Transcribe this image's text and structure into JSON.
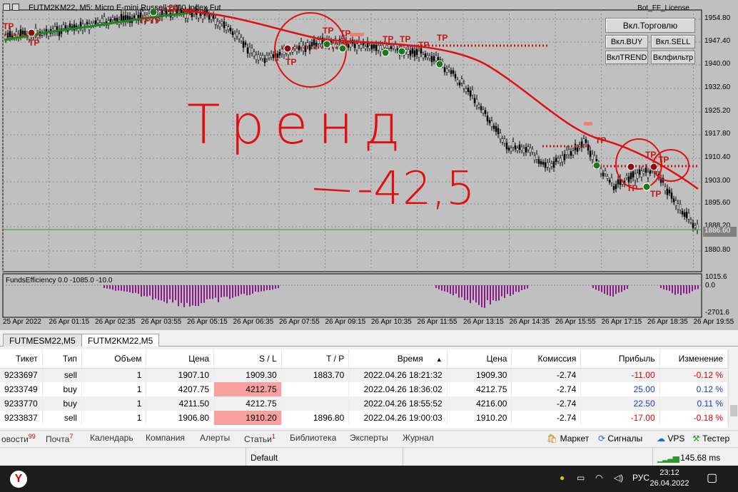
{
  "window": {
    "chart_title": "FUTM2KM22, M5:  Micro E-mini Russell 2000 Index Fut",
    "license_label": "Bot_FF_License"
  },
  "bot_buttons": {
    "trade_on": "Вкл.Торговлю",
    "buy_on": "Вкл.BUY",
    "sell_on": "Вкл.SELL",
    "trend_on": "ВклTREND",
    "filter_on": "Вклфильтр"
  },
  "price_axis": {
    "labels": [
      "1954.80",
      "1947.40",
      "1940.00",
      "1932.60",
      "1925.20",
      "1917.80",
      "1910.40",
      "1903.00",
      "1895.60",
      "1888.20",
      "1880.80"
    ],
    "current": "1886.60"
  },
  "time_axis": {
    "labels": [
      "25 Apr 2022",
      "26 Apr 01:15",
      "26 Apr 02:35",
      "26 Apr 03:55",
      "26 Apr 05:15",
      "26 Apr 06:35",
      "26 Apr 07:55",
      "26 Apr 09:15",
      "26 Apr 10:35",
      "26 Apr 11:55",
      "26 Apr 13:15",
      "26 Apr 14:35",
      "26 Apr 15:55",
      "26 Apr 17:15",
      "26 Apr 18:35",
      "26 Apr 19:55"
    ]
  },
  "indicator": {
    "label": "FundsEfficiency 0.0 -1085.0 -10.0",
    "axis_top": "1015.6",
    "axis_zero": "0.0",
    "axis_bottom": "-2701.6"
  },
  "annotation": {
    "line1": "Тренд",
    "line2": "-42,5"
  },
  "markers": {
    "tp": "TP"
  },
  "chart_tabs": [
    {
      "label": "FUTMESM22,M5",
      "active": false
    },
    {
      "label": "FUTM2KM22,M5",
      "active": true
    }
  ],
  "positions": {
    "headers": [
      "Тикет",
      "Тип",
      "Объем",
      "Цена",
      "S / L",
      "T / P",
      "Время",
      "Цена",
      "Комиссия",
      "Прибыль",
      "Изменение"
    ],
    "sort_indicator": "▲",
    "rows": [
      {
        "ticket": "9233697",
        "type": "sell",
        "volume": "1",
        "price": "1907.10",
        "sl": "1909.30",
        "tp": "1883.70",
        "time": "2022.04.26 18:21:32",
        "cur": "1909.30",
        "commission": "-2.74",
        "profit": "-11.00",
        "change": "-0.12 %"
      },
      {
        "ticket": "9233749",
        "type": "buy",
        "volume": "1",
        "price": "4207.75",
        "sl": "4212.75",
        "tp": "",
        "time": "2022.04.26 18:36:02",
        "cur": "4212.75",
        "commission": "-2.74",
        "profit": "25.00",
        "change": "0.12 %"
      },
      {
        "ticket": "9233770",
        "type": "buy",
        "volume": "1",
        "price": "4211.50",
        "sl": "4212.75",
        "tp": "",
        "time": "2022.04.26 18:55:52",
        "cur": "4216.00",
        "commission": "-2.74",
        "profit": "22.50",
        "change": "0.11 %"
      },
      {
        "ticket": "9233837",
        "type": "sell",
        "volume": "1",
        "price": "1906.80",
        "sl": "1910.20",
        "tp": "1896.80",
        "time": "2022.04.26 19:00:03",
        "cur": "1910.20",
        "commission": "-2.74",
        "profit": "-17.00",
        "change": "-0.18 %"
      }
    ]
  },
  "bottom_tabs": [
    {
      "label": "овости",
      "badge": "99"
    },
    {
      "label": "Почта",
      "badge": "7"
    },
    {
      "label": "Календарь",
      "badge": ""
    },
    {
      "label": "Компания",
      "badge": ""
    },
    {
      "label": "Алерты",
      "badge": ""
    },
    {
      "label": "Статьи",
      "badge": "1"
    },
    {
      "label": "Библиотека",
      "badge": ""
    },
    {
      "label": "Эксперты",
      "badge": ""
    },
    {
      "label": "Журнал",
      "badge": ""
    }
  ],
  "services": {
    "market": "Маркет",
    "signals": "Сигналы",
    "vps": "VPS",
    "tester": "Тестер"
  },
  "status": {
    "profile": "Default",
    "ping": "145.68 ms"
  },
  "taskbar": {
    "lang": "РУС",
    "time": "23:12",
    "date": "26.04.2022"
  },
  "colors": {
    "trend_line": "#e01010",
    "ma_line": "#1a8a1a",
    "tp_marker": "#c01818",
    "indicator_bar": "#8a1a8a",
    "loss_cell": "#f8a0a0",
    "profit_text": "#1a3bd0",
    "loss_text": "#e00000"
  }
}
